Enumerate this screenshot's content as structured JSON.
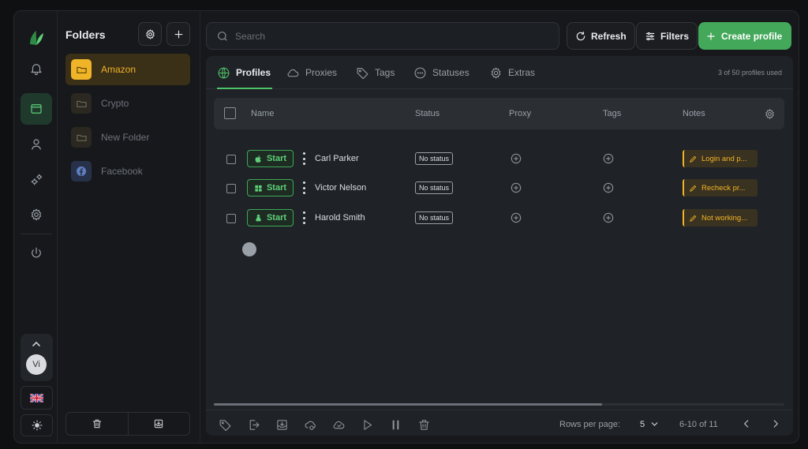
{
  "folders": {
    "title": "Folders",
    "items": [
      {
        "label": "Amazon",
        "active": true
      },
      {
        "label": "Crypto",
        "active": false
      },
      {
        "label": "New Folder",
        "active": false
      },
      {
        "label": "Facebook",
        "active": false
      }
    ]
  },
  "user": {
    "initials": "Vi"
  },
  "search": {
    "placeholder": "Search"
  },
  "toolbar": {
    "refresh_label": "Refresh",
    "filters_label": "Filters",
    "create_label": "Create profile"
  },
  "tabs": [
    {
      "label": "Profiles",
      "active": true
    },
    {
      "label": "Proxies",
      "active": false
    },
    {
      "label": "Tags",
      "active": false
    },
    {
      "label": "Statuses",
      "active": false
    },
    {
      "label": "Extras",
      "active": false
    }
  ],
  "usage_text": "3 of 50 profiles used",
  "table": {
    "columns": [
      "Name",
      "Status",
      "Proxy",
      "Tags",
      "Notes"
    ],
    "rows": [
      {
        "os": "apple-icon",
        "start_label": "Start",
        "name": "Carl Parker",
        "status": "No status",
        "note": "Login and p..."
      },
      {
        "os": "windows-icon",
        "start_label": "Start",
        "name": "Victor Nelson",
        "status": "No status",
        "note": "Recheck pr..."
      },
      {
        "os": "linux-icon",
        "start_label": "Start",
        "name": "Harold Smith",
        "status": "No status",
        "note": "Not working..."
      }
    ]
  },
  "pagination": {
    "rows_per_page_label": "Rows per page:",
    "rows_per_page": "5",
    "range": "6-10 of 11"
  },
  "colors": {
    "accent": "#43a85a",
    "folder_active": "#f0b429"
  }
}
